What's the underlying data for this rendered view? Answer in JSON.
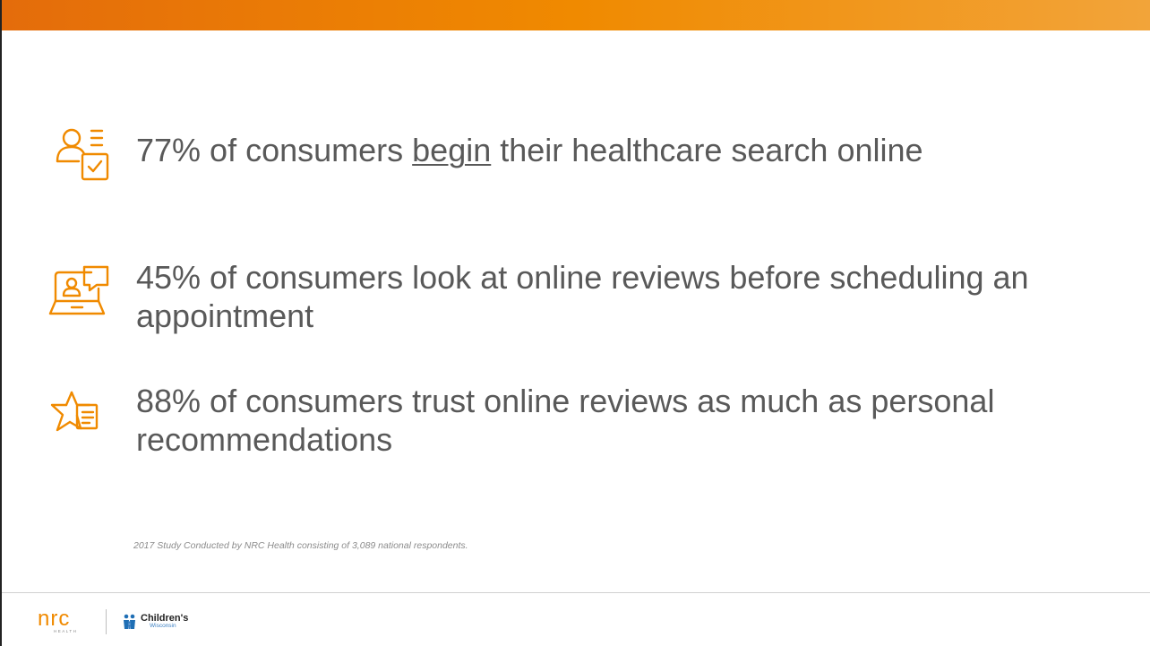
{
  "theme": {
    "accent": "#f08a00",
    "text": "#595959",
    "footnote": "#8c8c8c"
  },
  "stats": [
    {
      "icon": "user-checklist-icon",
      "prefix": "77% of consumers ",
      "emphasis": "begin",
      "suffix": " their healthcare search online"
    },
    {
      "icon": "laptop-review-icon",
      "text": "45% of consumers look at online reviews before scheduling an appointment"
    },
    {
      "icon": "star-list-icon",
      "text": "88% of consumers trust online reviews as much as personal recommendations"
    }
  ],
  "footnote": "2017 Study Conducted by NRC Health consisting of 3,089 national respondents.",
  "footer": {
    "nrc_logo": {
      "wordmark": "nrc",
      "sub": "HEALTH"
    },
    "childrens_logo": {
      "name": "Children's",
      "sub": "Wisconsin"
    }
  }
}
